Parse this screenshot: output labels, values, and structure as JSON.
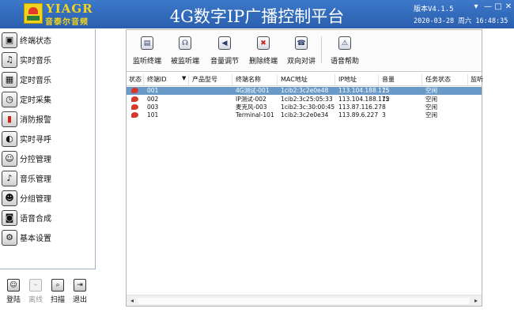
{
  "titlebar": {
    "logo_text_en": "YIAGR",
    "logo_text_cn": "音泰尔音频",
    "title": "4G数字IP广播控制平台",
    "version": "版本V4.1.5",
    "datetime": "2020-03-28 周六 16:48:35",
    "controls": [
      "▾",
      "—",
      "□",
      "✕"
    ]
  },
  "sidebar": {
    "items": [
      {
        "label": "终端状态",
        "icon": "monitor-icon",
        "glyph": "▣"
      },
      {
        "label": "实时音乐",
        "icon": "music-icon",
        "glyph": "♫"
      },
      {
        "label": "定时音乐",
        "icon": "calendar-icon",
        "glyph": "▦"
      },
      {
        "label": "定时采集",
        "icon": "clock-icon",
        "glyph": "◷"
      },
      {
        "label": "消防报警",
        "icon": "extinguisher-icon",
        "glyph": "▮"
      },
      {
        "label": "实时寻呼",
        "icon": "microphone-icon",
        "glyph": "◐"
      },
      {
        "label": "分控管理",
        "icon": "user-control-icon",
        "glyph": "☺"
      },
      {
        "label": "音乐管理",
        "icon": "music-file-icon",
        "glyph": "♪"
      },
      {
        "label": "分组管理",
        "icon": "group-icon",
        "glyph": "☻"
      },
      {
        "label": "语音合成",
        "icon": "speech-icon",
        "glyph": "◙"
      },
      {
        "label": "基本设置",
        "icon": "gear-icon",
        "glyph": "⚙"
      }
    ]
  },
  "bottom_actions": [
    {
      "label": "登陆",
      "icon": "login-icon",
      "glyph": "☺",
      "enabled": true
    },
    {
      "label": "离线",
      "icon": "offline-icon",
      "glyph": "⌁",
      "enabled": false
    },
    {
      "label": "扫描",
      "icon": "scan-icon",
      "glyph": "⌕",
      "enabled": true
    },
    {
      "label": "退出",
      "icon": "exit-icon",
      "glyph": "⇥",
      "enabled": true
    }
  ],
  "toolbar": {
    "buttons": [
      {
        "label": "监听终端",
        "icon": "monitor-terminal-icon",
        "glyph": "▤"
      },
      {
        "label": "被监听端",
        "icon": "headphone-icon",
        "glyph": "☊"
      },
      {
        "label": "音量调节",
        "icon": "speaker-icon",
        "glyph": "◀"
      },
      {
        "label": "删除终端",
        "icon": "delete-terminal-icon",
        "glyph": "✖"
      },
      {
        "label": "双向对讲",
        "icon": "phone-icon",
        "glyph": "☎"
      },
      {
        "label": "语音帮助",
        "icon": "warning-icon",
        "glyph": "⚠"
      }
    ]
  },
  "table": {
    "columns": [
      "状态",
      "终端ID",
      "产品型号",
      "终端名称",
      "MAC地址",
      "IP地址",
      "音量",
      "任务状态",
      "监听"
    ],
    "sort_indicator": "▼",
    "rows": [
      {
        "id": "001",
        "model": "",
        "name": "4G测试-001",
        "mac": "1cib2:3c2e0e48",
        "ip": "113.104.188.175",
        "volume": "15",
        "task": "空闲",
        "monitor": "",
        "selected": true
      },
      {
        "id": "002",
        "model": "",
        "name": "IP测试-002",
        "mac": "1cib2:3c25:05:33",
        "ip": "113.104.188.175",
        "volume": "12",
        "task": "空闲",
        "monitor": "",
        "selected": false
      },
      {
        "id": "003",
        "model": "",
        "name": "麦克风-003",
        "mac": "1cib2:3c:30:00:45",
        "ip": "113.87.116.27",
        "volume": "8",
        "task": "空闲",
        "monitor": "",
        "selected": false
      },
      {
        "id": "101",
        "model": "",
        "name": "Terminal-101",
        "mac": "1cib2:3c2e0e34",
        "ip": "113.89.6.227",
        "volume": "3",
        "task": "空闲",
        "monitor": "",
        "selected": false
      }
    ]
  },
  "scrollbar": {
    "left_arrow": "◂",
    "right_arrow": "▸"
  },
  "colors": {
    "titlebar": "#2f68b8",
    "logo": "#f3d51c",
    "selected_row": "#6a9ac8",
    "status_offline": "#d33a2c"
  }
}
